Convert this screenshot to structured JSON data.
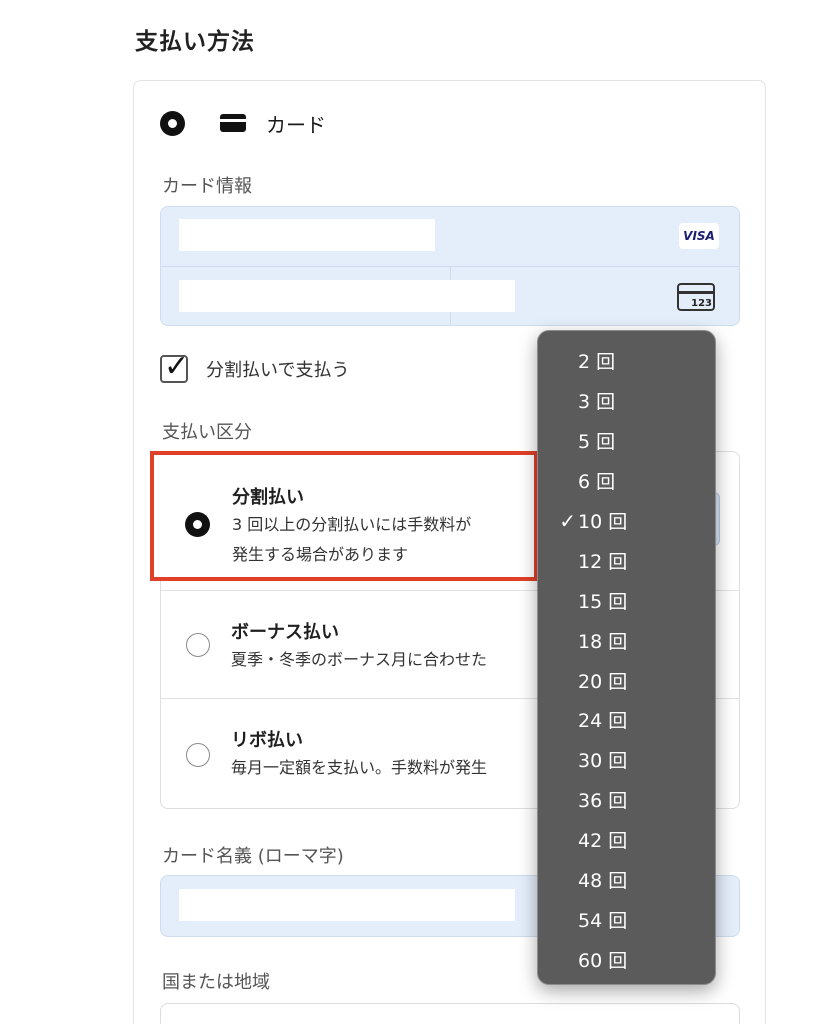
{
  "section_title": "支払い方法",
  "method": {
    "label": "カード",
    "icons": [
      "radio-selected-icon",
      "credit-card-icon"
    ]
  },
  "card_info": {
    "label": "カード情報",
    "brand": "VISA",
    "cvc_badge": "123"
  },
  "installment_checkbox": {
    "label": "分割払いで支払う",
    "checked": true
  },
  "payment_type": {
    "label": "支払い区分",
    "options": [
      {
        "title": "分割払い",
        "desc_line1": "3 回以上の分割払いには手数料が",
        "desc_line2": "発生する場合があります",
        "selected": true
      },
      {
        "title": "ボーナス払い",
        "desc_line1": "夏季・冬季のボーナス月に合わせた",
        "selected": false
      },
      {
        "title": "リボ払い",
        "desc_line1": "毎月一定額を支払い。手数料が発生",
        "selected": false
      }
    ]
  },
  "cardholder_name": {
    "label": "カード名義 (ローマ字)"
  },
  "country": {
    "label": "国または地域"
  },
  "installment_dropdown": {
    "selected": "10 回",
    "items": [
      "2 回",
      "3 回",
      "5 回",
      "6 回",
      "10 回",
      "12 回",
      "15 回",
      "18 回",
      "20 回",
      "24 回",
      "30 回",
      "36 回",
      "42 回",
      "48 回",
      "54 回",
      "60 回"
    ],
    "check_mark": "✓"
  },
  "colors": {
    "highlight_border": "#e04028",
    "field_background": "#e4eefb",
    "dropdown_background": "#5b5b5b"
  }
}
